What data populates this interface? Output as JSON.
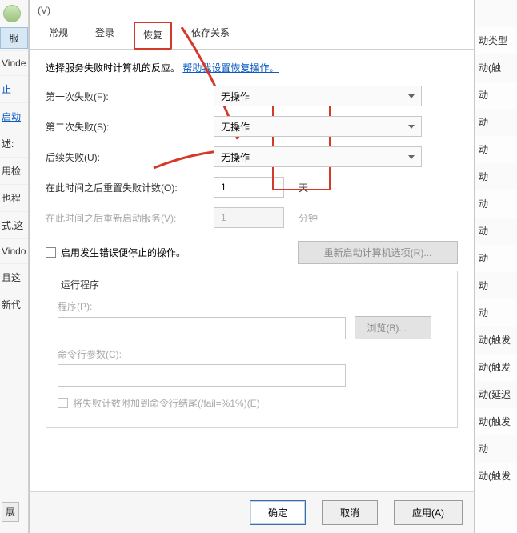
{
  "titlebar": "(V)",
  "tabs": {
    "general": "常规",
    "logon": "登录",
    "recovery": "恢复",
    "dependencies": "依存关系"
  },
  "desc_prefix": "选择服务失败时计算机的反应。",
  "desc_link": "帮助我设置恢复操作。",
  "labels": {
    "first_failure": "第一次失败(F):",
    "second_failure": "第二次失败(S):",
    "subsequent_failure": "后续失败(U):",
    "reset_fail_count": "在此时间之后重置失败计数(O):",
    "restart_service_after": "在此时间之后重新启动服务(V):",
    "days_unit": "天",
    "minutes_unit": "分钟",
    "enable_stop_actions": "启用发生错误便停止的操作。",
    "restart_computer_options": "重新启动计算机选项(R)...",
    "run_program_group": "运行程序",
    "program": "程序(P):",
    "browse": "浏览(B)...",
    "cmd_params": "命令行参数(C):",
    "append_fail": "将失败计数附加到命令行结尾(/fail=%1%)(E)"
  },
  "values": {
    "action_first": "无操作",
    "action_second": "无操作",
    "action_subsequent": "无操作",
    "reset_days": "1",
    "restart_minutes": "1"
  },
  "buttons": {
    "ok": "确定",
    "cancel": "取消",
    "apply": "应用(A)"
  },
  "left_bg": {
    "tab": "服",
    "cell_windows": "Vinde",
    "cell_link": "止",
    "cell_start": "启动",
    "cell_desc": "述:",
    "cell_use": "用检",
    "cell_other": "也程",
    "cell_this": "式,这",
    "cell_windo": "Vindo",
    "cell_and": "且这",
    "cell_new": "新代",
    "btn": "展"
  },
  "right_bg_cells": [
    "",
    "动类型",
    "动(触",
    "动",
    "动",
    "动",
    "动",
    "动",
    "动",
    "动",
    "动",
    "动",
    "动(触发",
    "动(触发",
    "动(延迟",
    "动(触发",
    "动",
    "动(触发"
  ]
}
